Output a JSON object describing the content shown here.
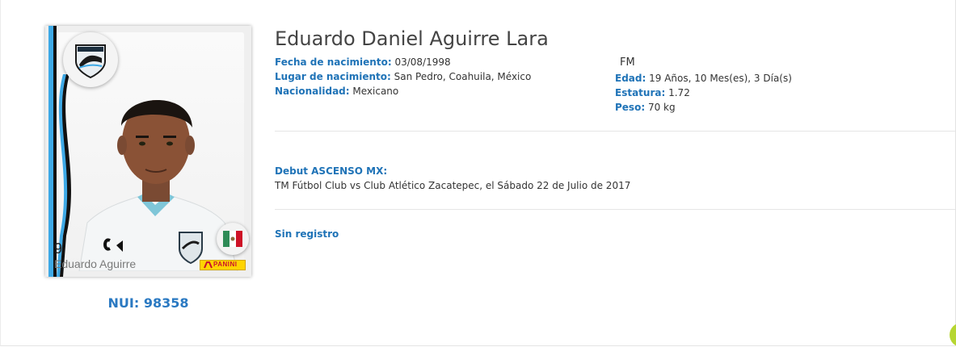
{
  "player": {
    "full_name": "Eduardo Daniel Aguirre Lara",
    "card_name": "Eduardo Aguirre",
    "number": "9",
    "nui": "NUI: 98358",
    "position": "FM"
  },
  "details_left": [
    {
      "label": "Fecha de nacimiento:",
      "value": "03/08/1998"
    },
    {
      "label": "Lugar de nacimiento:",
      "value": "San Pedro, Coahuila, México"
    },
    {
      "label": "Nacionalidad:",
      "value": "Mexicano"
    }
  ],
  "details_right": [
    {
      "label": "Edad:",
      "value": "19 Años, 10 Mes(es), 3 Día(s)"
    },
    {
      "label": "Estatura:",
      "value": "1.72"
    },
    {
      "label": "Peso:",
      "value": "70 kg"
    }
  ],
  "debut": {
    "title": "Debut ASCENSO MX:",
    "text": "TM Fútbol Club vs Club Atlético Zacatepec, el Sábado 22 de Julio de 2017"
  },
  "sin_registro": "Sin registro",
  "card": {
    "brand_label": "PANINI",
    "team_logo_icon": "tampico-madero-crest-icon",
    "flag_icon": "mexico-flag-icon"
  },
  "colors": {
    "accent_blue": "#1f73b7",
    "nui_blue": "#2a79c2",
    "stripe_light_blue": "#3ea9e6",
    "stripe_black": "#111111",
    "panini_yellow": "#ffd400"
  }
}
